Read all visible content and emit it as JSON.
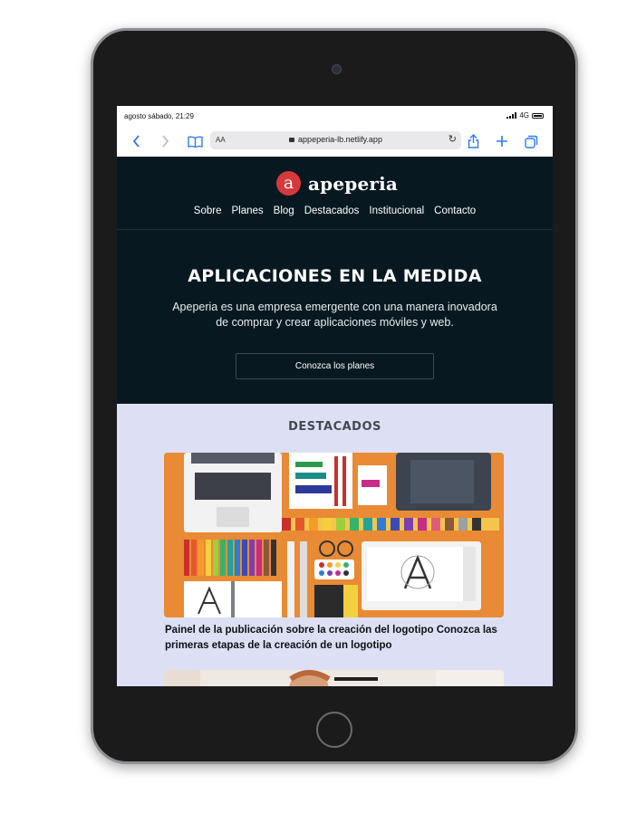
{
  "status": {
    "time": "agosto sábado, 21:29",
    "network": "4G"
  },
  "browser": {
    "text_size": "AA",
    "url": "appeperia-lb.netlify.app"
  },
  "site": {
    "brand": "apeperia",
    "logo_letter": "a",
    "nav": [
      "Sobre",
      "Planes",
      "Blog",
      "Destacados",
      "Institucional",
      "Contacto"
    ]
  },
  "hero": {
    "title": "APLICACIONES EN LA MEDIDA",
    "subtitle": "Apeperia es una empresa emergente con una manera inovadora de comprar y crear aplicaciones móviles y web.",
    "cta": "Conozca los planes"
  },
  "featured": {
    "heading": "DESTACADOS",
    "cards": [
      {
        "title": "Painel de la publicación sobre la creación del logotipo Conozca las primeras etapas de la creación de un logotipo"
      }
    ]
  },
  "colors": {
    "brand_red": "#d5393c",
    "dark": "#071820",
    "featured_bg": "#dde0f4",
    "accent_blue": "#2f7bf0",
    "illustration_orange": "#e98a35"
  },
  "icons": [
    "back-icon",
    "forward-icon",
    "bookmarks-icon",
    "lock-icon",
    "reload-icon",
    "share-icon",
    "new-tab-icon",
    "tabs-icon",
    "signal-icon",
    "battery-icon"
  ]
}
